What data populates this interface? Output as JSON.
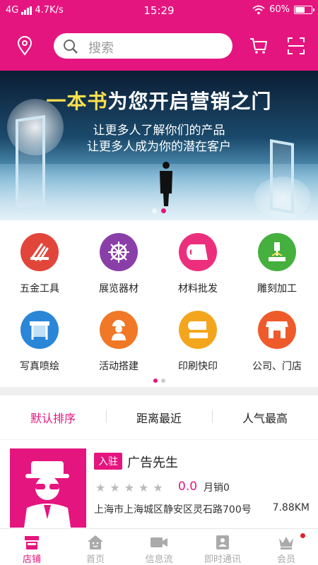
{
  "status_bar": {
    "network": "4G",
    "speed": "4.7K/s",
    "time": "15:29",
    "battery": "60%",
    "battery_level": 0.6
  },
  "header": {
    "search_placeholder": "搜索",
    "icons": [
      "location-icon",
      "cart-icon",
      "scan-icon"
    ]
  },
  "banner": {
    "headline_prefix": "一本书",
    "headline_rest": "为您开启营销之门",
    "line1": "让更多人了解你们的产品",
    "line2": "让更多人成为你的潜在客户",
    "slide_count": 2,
    "active_slide": 1
  },
  "categories": {
    "items": [
      {
        "label": "五金工具",
        "icon": "tools-icon",
        "color": "#e2463a"
      },
      {
        "label": "展览器材",
        "icon": "ship-wheel-icon",
        "color": "#8a3fa8"
      },
      {
        "label": "材料批发",
        "icon": "paper-roll-icon",
        "color": "#ec2f7d"
      },
      {
        "label": "雕刻加工",
        "icon": "engraving-icon",
        "color": "#45b03e"
      },
      {
        "label": "写真喷绘",
        "icon": "printer-icon",
        "color": "#2a86d6"
      },
      {
        "label": "活动搭建",
        "icon": "worker-icon",
        "color": "#f07826"
      },
      {
        "label": "印刷快印",
        "icon": "print-machine-icon",
        "color": "#f3a61d"
      },
      {
        "label": "公司、门店",
        "icon": "storefront-icon",
        "color": "#ef5a2b"
      }
    ],
    "page_count": 2,
    "active_page": 1
  },
  "sort": {
    "options": [
      "默认排序",
      "距离最近",
      "人气最高"
    ],
    "active": 0
  },
  "shop": {
    "badge": "入驻",
    "name": "广告先生",
    "rating": "0.0",
    "stars": 5,
    "sales": "月销0",
    "address": "上海市上海城区静安区灵石路700号",
    "distance": "7.88KM"
  },
  "tabbar": {
    "tabs": [
      {
        "label": "店铺",
        "icon": "shop-icon"
      },
      {
        "label": "首页",
        "icon": "home-icon"
      },
      {
        "label": "信息流",
        "icon": "video-icon"
      },
      {
        "label": "即时通讯",
        "icon": "contacts-icon"
      },
      {
        "label": "会员",
        "icon": "crown-icon"
      }
    ],
    "active": 0,
    "badge_on": 4
  },
  "colors": {
    "brand": "#e5157f",
    "background": "#efefef"
  }
}
